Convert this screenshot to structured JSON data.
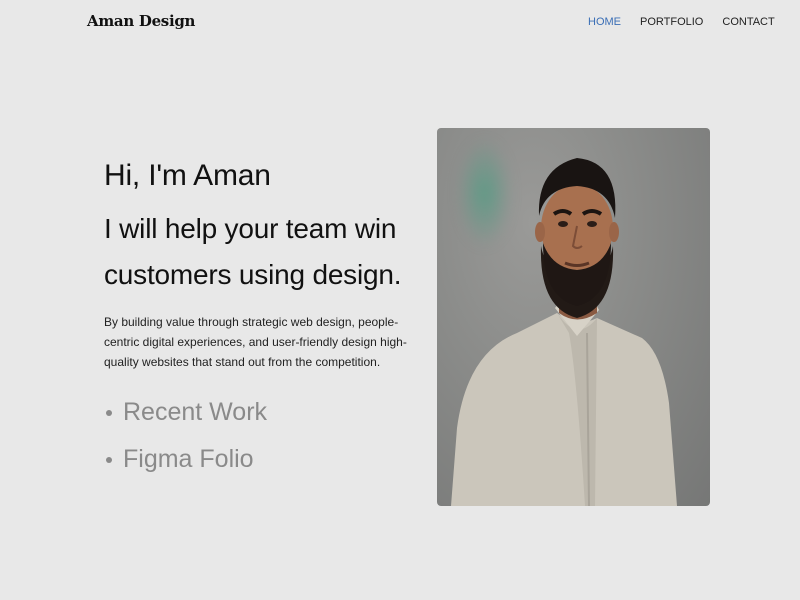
{
  "header": {
    "brand": "Aman Design",
    "nav": [
      {
        "label": "HOME",
        "active": true
      },
      {
        "label": "PORTFOLIO",
        "active": false
      },
      {
        "label": "CONTACT",
        "active": false
      }
    ]
  },
  "hero": {
    "greeting": "Hi, I'm Aman",
    "headline_line1": "I will help your team win",
    "headline_line2": "customers using design.",
    "blurb": "By building value through strategic web design, people-centric digital experiences, and user-friendly design high-quality websites that stand out from the competition.",
    "links": [
      "Recent Work",
      "Figma Folio"
    ]
  },
  "colors": {
    "background": "#e8e8e8",
    "nav_active": "#3b6fb6",
    "link_gray": "#8a8a8a"
  }
}
